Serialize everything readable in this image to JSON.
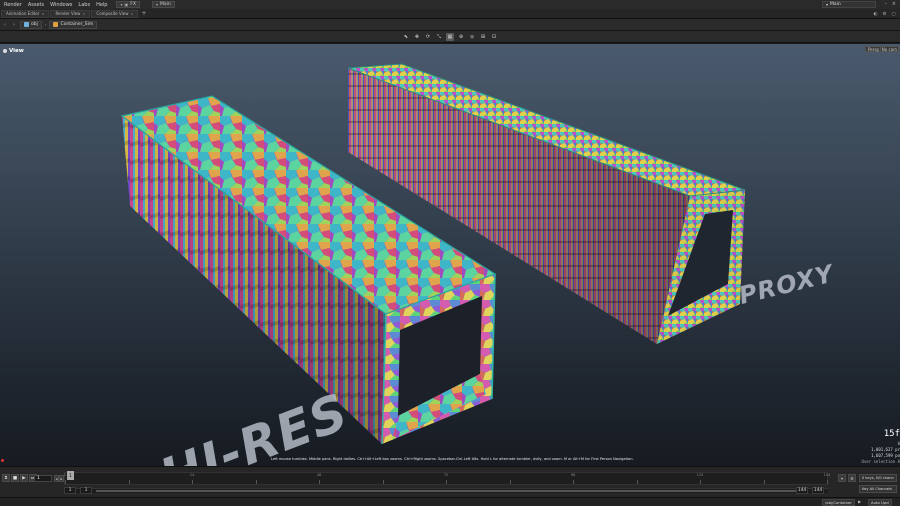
{
  "menubar": {
    "items": [
      "Render",
      "Assets",
      "Windows",
      "Labs",
      "Help"
    ],
    "desktop": "FX",
    "main_label": "Main"
  },
  "tabs": [
    "Animation Editor",
    "Render View",
    "Composite View"
  ],
  "path": {
    "obj": "obj",
    "node": "Container_Sim"
  },
  "viewport": {
    "name": "View",
    "persp_label": "Persp",
    "cam_label": "No cam",
    "label_hires": "HI-RES",
    "label_proxy": "PROXY",
    "hint": "Left mouse tumbles. Middle pans. Right dollies. Ctrl+Alt+Left box zooms. Ctrl+Right zooms. Spacebar-Ctrl-Left tilts. Hold L for alternate tumbler, dolly, and zoom. M or Alt+M for First Person Navigation.",
    "stats": {
      "fps": "15f",
      "line1": "0",
      "line2": "1,001,627  pr",
      "line3": "1,607,599  po",
      "line4": "User selection A"
    }
  },
  "timeline": {
    "current_frame": "1",
    "ticks": [
      "1",
      "",
      "24",
      "",
      "48",
      "",
      "72",
      "",
      "96",
      "",
      "120",
      "",
      "144"
    ],
    "range_start": "1",
    "range_start2": "1",
    "range_end": "144",
    "range_end2": "144",
    "keys_label": "0 keys, 0/0 chann",
    "key_all_label": "Key All Channels"
  },
  "statusbar": {
    "path_chip": "/obj/Container",
    "autoupdate": "Auto Upd"
  }
}
